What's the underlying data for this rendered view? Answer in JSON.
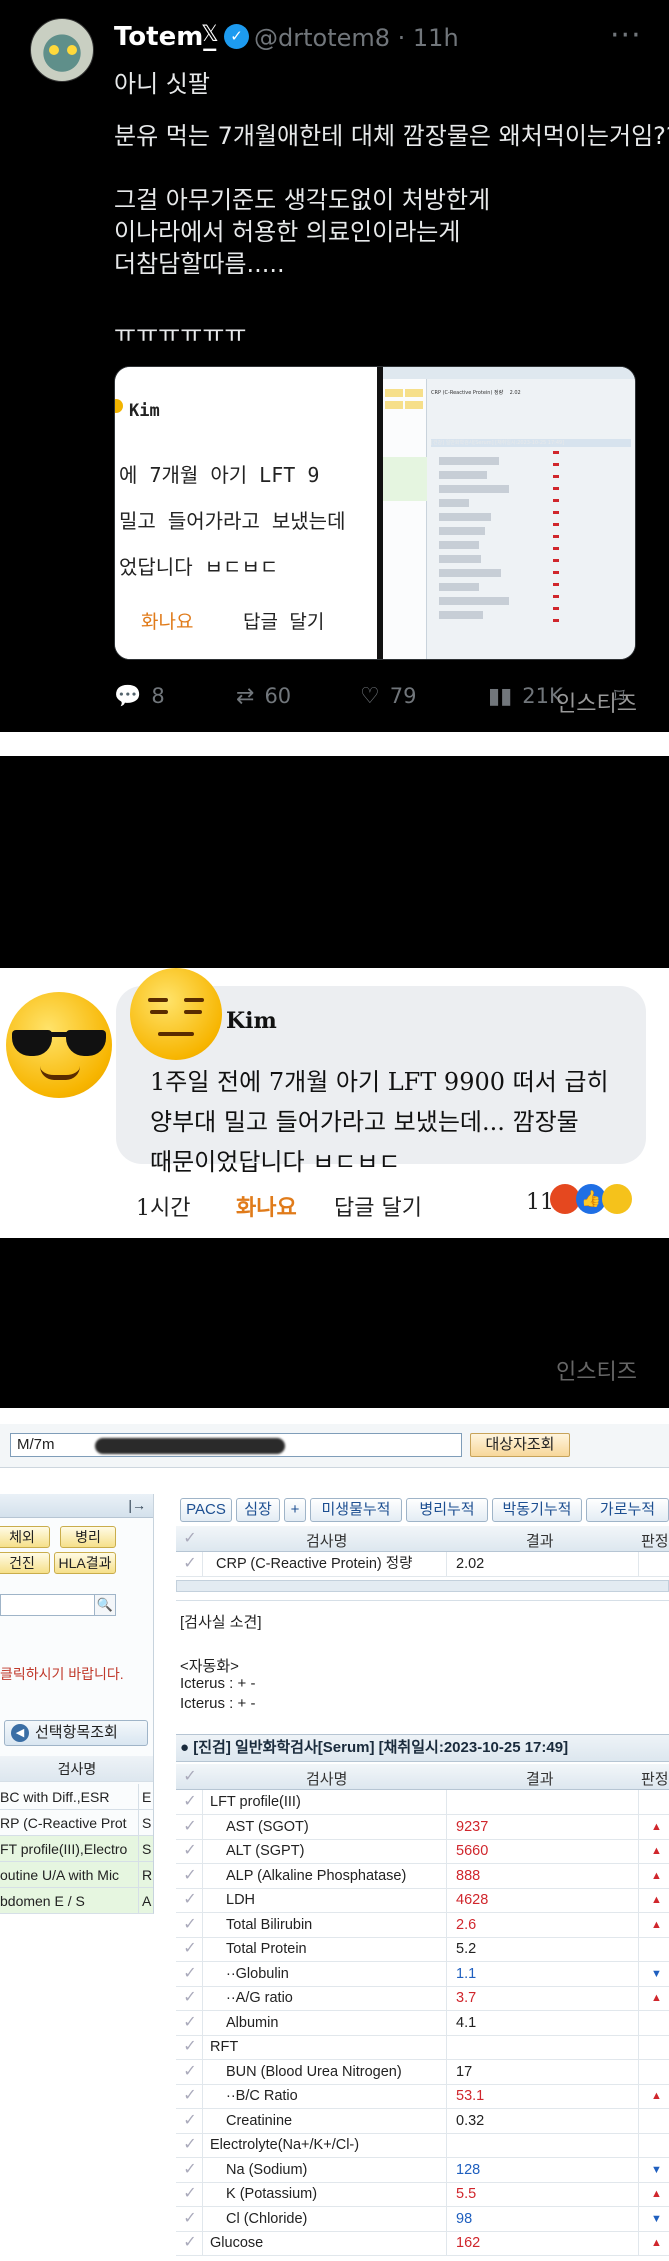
{
  "tweet": {
    "name": "Totem_",
    "handle": "@drtotem8 · 11h",
    "lines": [
      "아니 싯팔",
      "분유 먹는 7개월애한테 대체 깜장물은 왜처먹이는거임??",
      "그걸 아무기준도 생각도없이 처방한게",
      "이나라에서 허용한 의료인이라는게",
      "더참담할따름.....",
      "ㅠㅠㅠㅠㅠㅠ"
    ],
    "media_left": {
      "author": "Kim",
      "line1": "에   7개월 아기 LFT 9",
      "line2": "밀고  들어가라고  보냈는데",
      "line3": "었답니다 ㅂㄷㅂㄷ",
      "angry": "화나요",
      "reply": "답글 달기"
    },
    "media_right": {
      "row_crp": "CRP (C-Reactive Protein) 정량",
      "row_crp_val": "2.02",
      "header": "[건강]  일반화학검사[Serum]   [채취일시:2023-10-25 17:49]",
      "left_items": [
        "BC with Diff.,ESR",
        "RP (C-Reactive Prot",
        "T profile(III),Electro",
        "utine U/A with Mic",
        "domen E / S"
      ]
    },
    "actions": {
      "replies": "8",
      "retweets": "60",
      "likes": "79",
      "views": "21K"
    },
    "watermark": "인스티즈"
  },
  "comment": {
    "author": "Kim",
    "line1": "1주일 전에   7개월 아기 LFT 9900 떠서 급히",
    "line2": "양부대 밀고 들어가라고 보냈는데... 깜장물",
    "line3": "때문이었답니다 ㅂㄷㅂㄷ",
    "time": "1시간",
    "angry": "화나요",
    "reply": "답글 달기",
    "reaction_count": "11",
    "watermark": "인스티즈"
  },
  "emr": {
    "patient": "M/7m",
    "lookup_button": "대상자조회",
    "left_buttons": [
      "체외",
      "병리",
      "건진",
      "HLA결과"
    ],
    "notice": "클릭하시기 바랍니다.",
    "select_button": "선택항목조회",
    "left_header": "검사명",
    "left_items": [
      {
        "name": "BC with Diff.,ESR",
        "col": "E"
      },
      {
        "name": "RP (C-Reactive Prot",
        "col": "S"
      },
      {
        "name": "FT profile(III),Electro",
        "col": "S"
      },
      {
        "name": "outine U/A with Mic",
        "col": "R"
      },
      {
        "name": "bdomen E / S",
        "col": "A"
      }
    ],
    "tabs": [
      "PACS",
      "심장",
      "+",
      "미생물누적",
      "병리누적",
      "박동기누적",
      "가로누적"
    ],
    "grid_headers": {
      "name": "검사명",
      "result": "결과",
      "flag": "판정"
    },
    "crp_row": {
      "name": "CRP (C-Reactive Protein) 정량",
      "value": "2.02"
    },
    "lab_note_title": "[검사실 소견]",
    "auto": "<자동화>",
    "icterus1": "Icterus : + -",
    "icterus2": "Icterus : + -",
    "panel_header": "● [진검]  일반화학검사[Serum]   [채취일시:2023-10-25 17:49]",
    "rows": [
      {
        "name": "LFT profile(III)",
        "value": "",
        "flag": "",
        "level": "",
        "indent": 0
      },
      {
        "name": "AST (SGOT)",
        "value": "9237",
        "flag": "▲",
        "level": "high",
        "indent": 1
      },
      {
        "name": "ALT (SGPT)",
        "value": "5660",
        "flag": "▲",
        "level": "high",
        "indent": 1
      },
      {
        "name": "ALP (Alkaline Phosphatase)",
        "value": "888",
        "flag": "▲",
        "level": "high",
        "indent": 1
      },
      {
        "name": "LDH",
        "value": "4628",
        "flag": "▲",
        "level": "high",
        "indent": 1
      },
      {
        "name": "Total Bilirubin",
        "value": "2.6",
        "flag": "▲",
        "level": "high",
        "indent": 1
      },
      {
        "name": "Total Protein",
        "value": "5.2",
        "flag": "",
        "level": "",
        "indent": 1
      },
      {
        "name": "··Globulin",
        "value": "1.1",
        "flag": "▼",
        "level": "low",
        "indent": 1
      },
      {
        "name": "··A/G ratio",
        "value": "3.7",
        "flag": "▲",
        "level": "high",
        "indent": 1
      },
      {
        "name": "Albumin",
        "value": "4.1",
        "flag": "",
        "level": "",
        "indent": 1
      },
      {
        "name": "RFT",
        "value": "",
        "flag": "",
        "level": "",
        "indent": 0
      },
      {
        "name": "BUN (Blood Urea Nitrogen)",
        "value": "17",
        "flag": "",
        "level": "",
        "indent": 1
      },
      {
        "name": "··B/C Ratio",
        "value": "53.1",
        "flag": "▲",
        "level": "high",
        "indent": 1
      },
      {
        "name": "Creatinine",
        "value": "0.32",
        "flag": "",
        "level": "",
        "indent": 1
      },
      {
        "name": "Electrolyte(Na+/K+/Cl-)",
        "value": "",
        "flag": "",
        "level": "",
        "indent": 0
      },
      {
        "name": "Na (Sodium)",
        "value": "128",
        "flag": "▼",
        "level": "low",
        "indent": 1
      },
      {
        "name": "K (Potassium)",
        "value": "5.5",
        "flag": "▲",
        "level": "high",
        "indent": 1
      },
      {
        "name": "Cl (Chloride)",
        "value": "98",
        "flag": "▼",
        "level": "low",
        "indent": 1
      },
      {
        "name": "Glucose",
        "value": "162",
        "flag": "▲",
        "level": "high",
        "indent": 0
      }
    ]
  }
}
